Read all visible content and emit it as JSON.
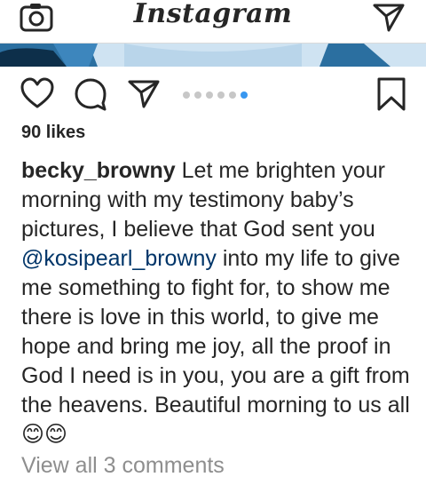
{
  "header": {
    "logo_text": "Instagram",
    "camera_icon": "camera-icon",
    "direct_icon": "paper-plane-icon"
  },
  "post": {
    "photo_colors": {
      "sky": "#2b6fa0",
      "light": "#cfe3f2",
      "dark": "#0d2f4a"
    },
    "carousel": {
      "count": 5,
      "active_index": 4,
      "active_color": "#3897f0",
      "inactive_color": "#c7c7c7"
    },
    "actions": {
      "like_icon": "heart-icon",
      "comment_icon": "comment-icon",
      "share_icon": "paper-plane-icon",
      "save_icon": "bookmark-icon"
    },
    "likes_text": "90 likes",
    "caption": {
      "username": "becky_browny",
      "text_1": "Let me brighten your morning with my testimony baby’s pictures, I believe that God sent you",
      "mention": "@kosipearl_browny",
      "text_2": "into my life to give me something to fight for, to show me there is love in this world, to give me hope and bring me joy, all the proof in God I need is in you, you are a gift from the heavens. Beautiful morning to us all 😊😊"
    },
    "view_comments": "View all 3 comments",
    "mention_color": "#003569"
  }
}
